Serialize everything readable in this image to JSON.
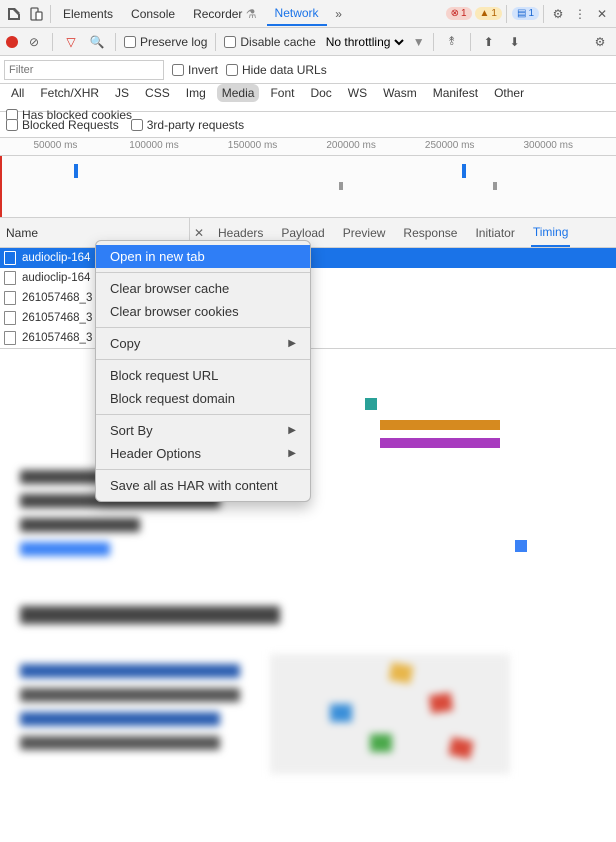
{
  "top_tabs": [
    "Elements",
    "Console",
    "Recorder",
    "Network"
  ],
  "top_active": "Network",
  "badges": {
    "error": "1",
    "warn": "1",
    "info": "1"
  },
  "toolbar2": {
    "preserve": "Preserve log",
    "disable_cache": "Disable cache",
    "throttle": "No throttling"
  },
  "filter": {
    "placeholder": "Filter",
    "invert": "Invert",
    "hide_data": "Hide data URLs"
  },
  "chips": [
    "All",
    "Fetch/XHR",
    "JS",
    "CSS",
    "Img",
    "Media",
    "Font",
    "Doc",
    "WS",
    "Wasm",
    "Manifest",
    "Other"
  ],
  "chip_active": "Media",
  "blocked_cookies": "Has blocked cookies",
  "blocked_requests": "Blocked Requests",
  "third_party": "3rd-party requests",
  "ruler": [
    "50000 ms",
    "100000 ms",
    "150000 ms",
    "200000 ms",
    "250000 ms",
    "300000 ms"
  ],
  "panes": {
    "name": "Name",
    "tabs": [
      "Headers",
      "Payload",
      "Preview",
      "Response",
      "Initiator",
      "Timing"
    ],
    "active": "Timing"
  },
  "requests": [
    {
      "label": "audioclip-164",
      "selected": true
    },
    {
      "label": "audioclip-164",
      "selected": false
    },
    {
      "label": "261057468_3",
      "selected": false
    },
    {
      "label": "261057468_3",
      "selected": false
    },
    {
      "label": "261057468_3",
      "selected": false
    }
  ],
  "ctx": {
    "open_new_tab": "Open in new tab",
    "clear_cache": "Clear browser cache",
    "clear_cookies": "Clear browser cookies",
    "copy": "Copy",
    "block_url": "Block request URL",
    "block_domain": "Block request domain",
    "sort_by": "Sort By",
    "header_opts": "Header Options",
    "save_har": "Save all as HAR with content"
  }
}
